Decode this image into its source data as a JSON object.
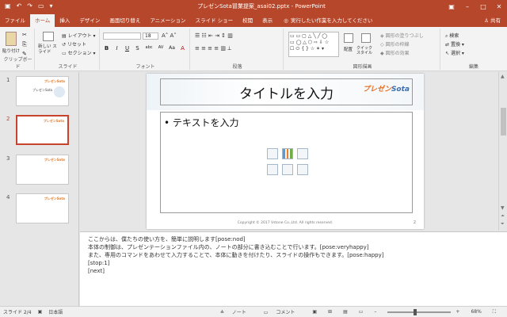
{
  "window": {
    "title": "プレゼンSota冒業提案_asai02.pptx  -  PowerPoint"
  },
  "tabs": [
    "ファイル",
    "ホーム",
    "挿入",
    "デザイン",
    "画面切り替え",
    "アニメーション",
    "スライド ショー",
    "校閲",
    "表示"
  ],
  "tell_me": "実行したい作業を入力してください",
  "share": "共有",
  "ribbon": {
    "clipboard": {
      "paste": "貼り付け",
      "label": "クリップボード"
    },
    "slides": {
      "new_slide": "新しい スライド",
      "layout": "レイアウト",
      "reset": "リセット",
      "section": "セクション",
      "label": "スライド"
    },
    "font": {
      "size": "18",
      "label": "フォント",
      "buttons": [
        "B",
        "I",
        "U",
        "S",
        "abc",
        "AV",
        "Aa",
        "A"
      ]
    },
    "paragraph": {
      "label": "段落"
    },
    "drawing": {
      "arrange": "配置",
      "quick_styles": "クイック スタイル",
      "fill": "図形の塗りつぶし",
      "outline": "図形の枠線",
      "effects": "図形の効果",
      "label": "図形描画"
    },
    "editing": {
      "find": "検索",
      "replace": "置換",
      "select": "選択",
      "label": "編集"
    }
  },
  "thumbnails": [
    {
      "num": "1",
      "logo": "プレゼンSota",
      "title": "プレゼンSota"
    },
    {
      "num": "2",
      "logo": "プレゼンSota"
    },
    {
      "num": "3",
      "logo": "プレゼンSota"
    },
    {
      "num": "4",
      "logo": "プレゼンSota"
    }
  ],
  "slide": {
    "title": "タイトルを入力",
    "logo_a": "プレゼン",
    "logo_b": "Sota",
    "bullet": "• テキストを入力",
    "footer": "Copyright © 2017 Vstone Co.,Ltd. All rights reserved.",
    "number": "2"
  },
  "notes": [
    "ここからは、僕たちの使い方を、簡単に説明します[pose:nod]",
    "本体の制御は、プレゼンテーションファイル内の、ノートの部分に書き込むことで行います。[pose:veryhappy]",
    "また、専用のコマンドをあわせて入力することで、本体に動きを付けたり、スライドの操作もできます。[pose:happy]",
    "[stop:1]",
    "[next]"
  ],
  "status": {
    "slide": "スライド 2/4",
    "language": "日本語",
    "notes": "ノート",
    "comments": "コメント",
    "zoom": "68%"
  },
  "colors": {
    "accent": "#b7472a",
    "logo_orange": "#e76d21"
  }
}
